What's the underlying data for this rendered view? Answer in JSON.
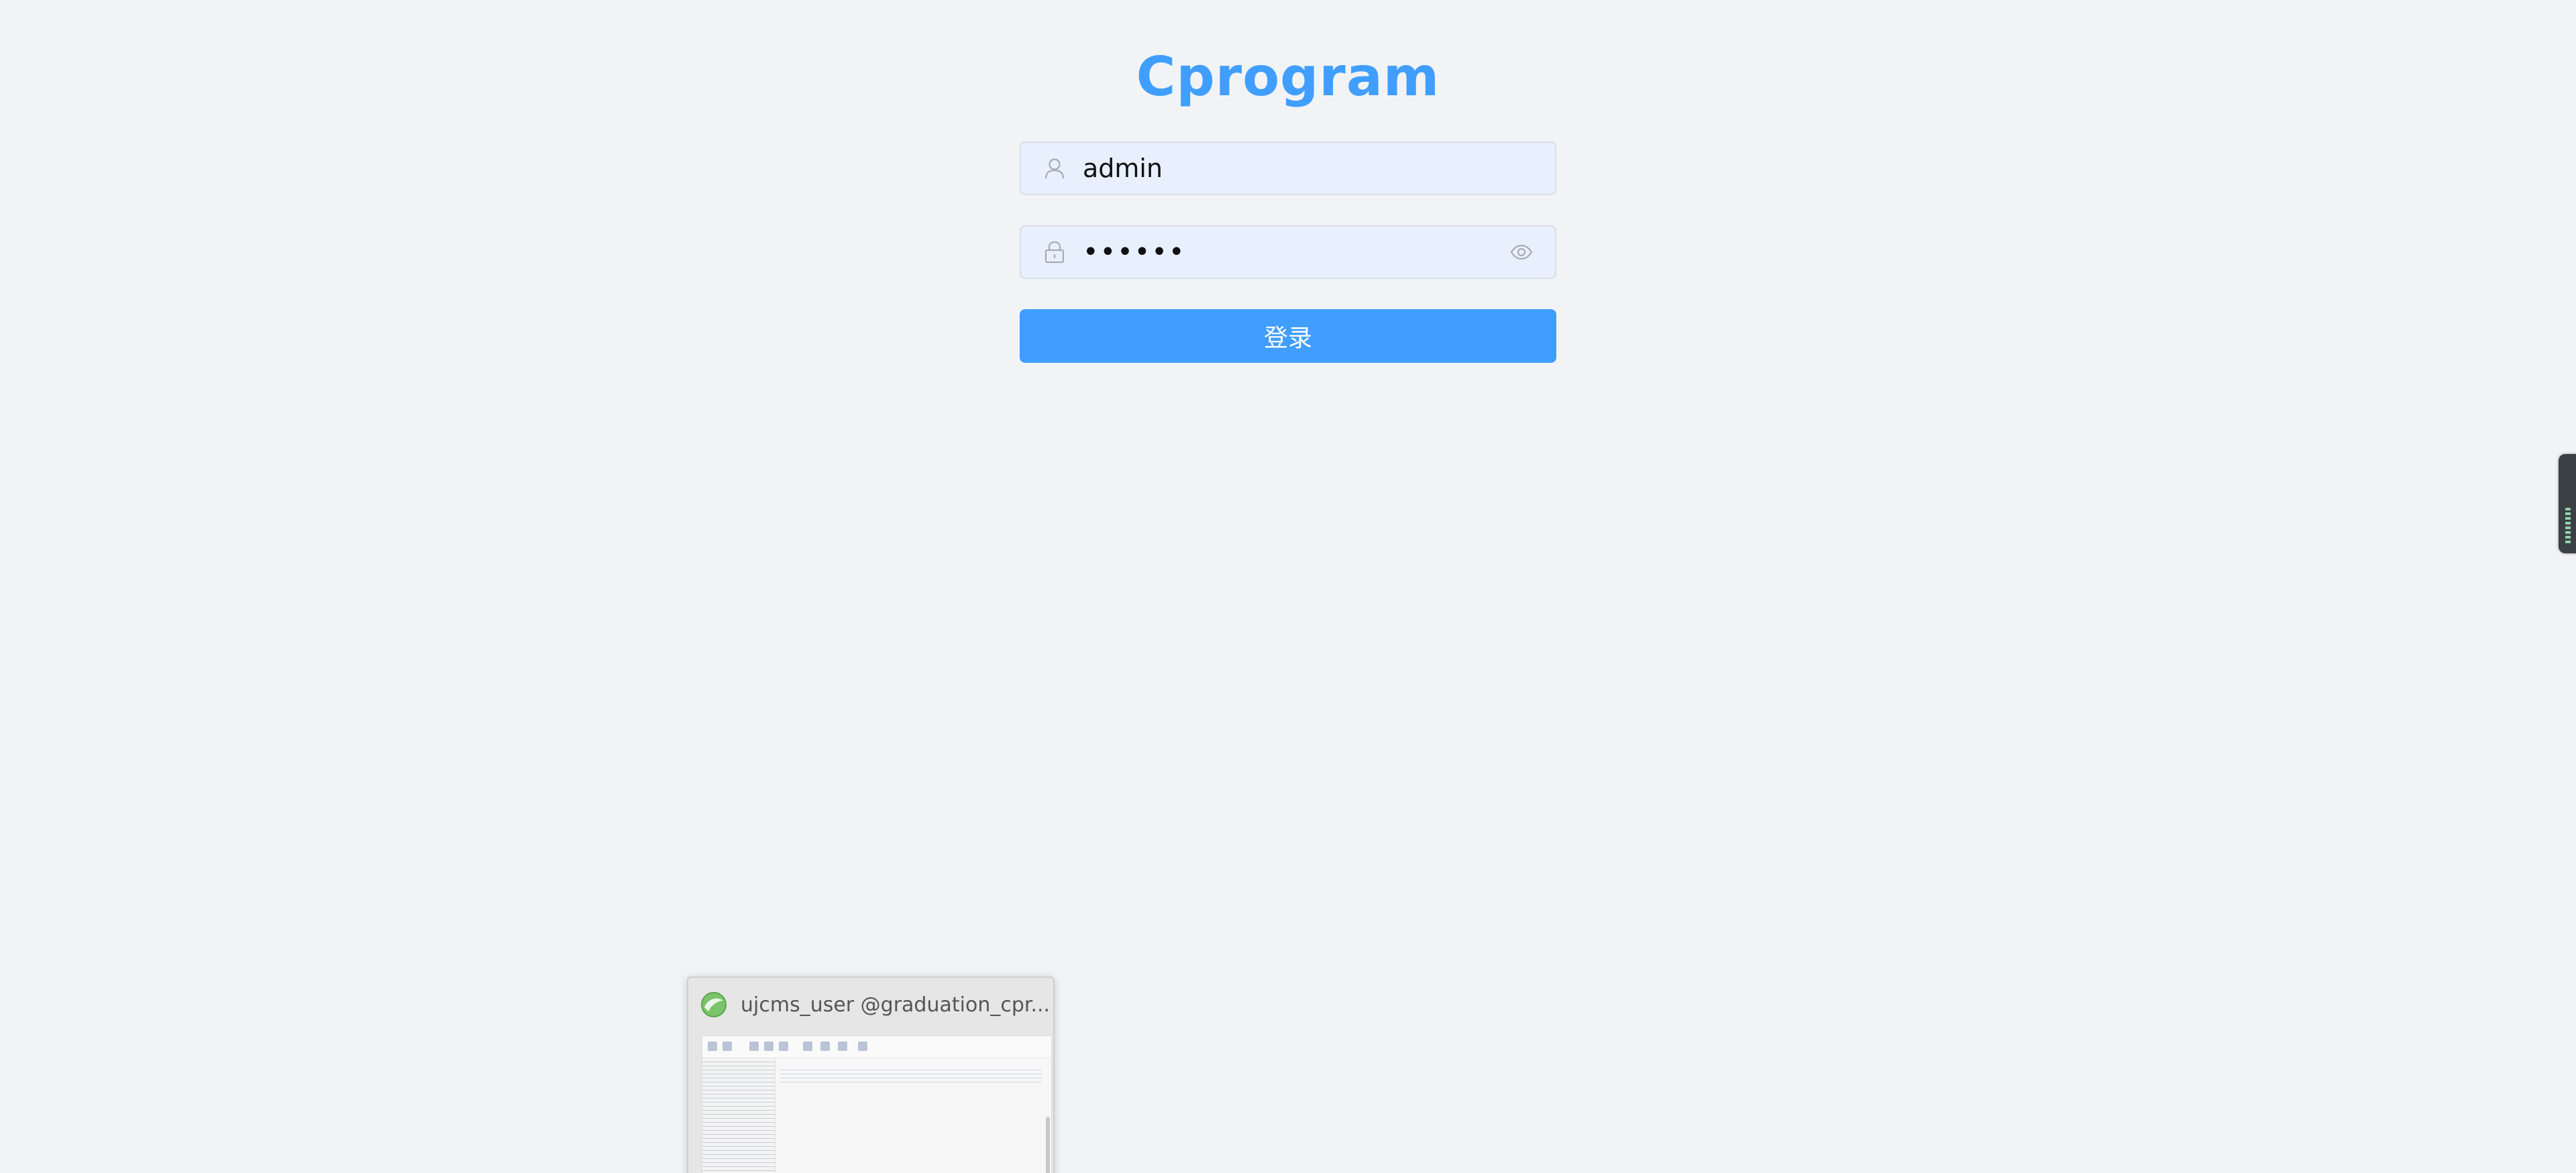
{
  "app": {
    "title": "Cprogram"
  },
  "login_form": {
    "username": {
      "value": "admin",
      "icon": "user-icon"
    },
    "password": {
      "value": "admin1",
      "icon": "lock-icon",
      "toggle_icon": "eye-icon"
    },
    "submit_label": "登录"
  },
  "taskbar_preview": {
    "title": "ujcms_user @graduation_cpr...",
    "icon": "navicat-app-icon"
  },
  "colors": {
    "brand": "#409eff",
    "background": "#f2f3f5",
    "input_fill": "#e8f0fe"
  }
}
